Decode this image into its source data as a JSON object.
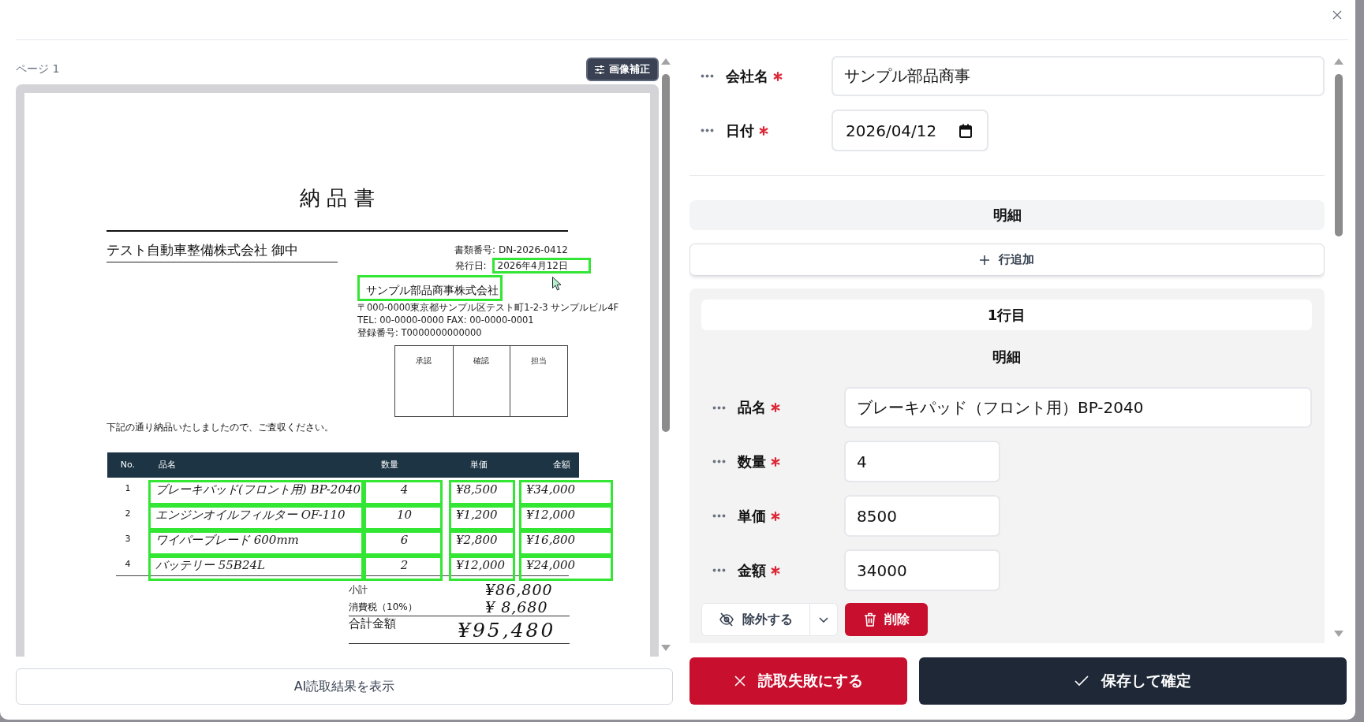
{
  "document_panel": {
    "page_label": "ページ 1",
    "adjust_button": "画像補正",
    "show_result_button": "AI読取結果を表示"
  },
  "document": {
    "title": "納 品 書",
    "recipient": "テスト自動車整備株式会社 御中",
    "meta": [
      {
        "label": "書類番号:",
        "value": "DN-2026-0412",
        "detected": false
      },
      {
        "label": "発行日:",
        "value": "2026年4月12日",
        "detected": true
      }
    ],
    "sender": {
      "name": "サンプル部品商事株式会社",
      "detected": true,
      "lines": [
        "〒000-0000東京都サンプル区テスト町1-2-3 サンプルビル4F",
        "TEL: 00-0000-0000 FAX: 00-0000-0001",
        "登録番号: T0000000000000"
      ]
    },
    "stamps": [
      "承認",
      "確認",
      "担当"
    ],
    "message": "下記の通り納品いたしましたので、ご査収ください。",
    "table": {
      "columns": [
        "No.",
        "品名",
        "数量",
        "単価",
        "金額"
      ],
      "rows": [
        {
          "cells": [
            {
              "text": "1",
              "detected": false
            },
            {
              "text": "ブレーキパッド(フロント用) BP-2040",
              "detected": true
            },
            {
              "text": "4",
              "detected": true
            },
            {
              "text": "¥8,500",
              "detected": true
            },
            {
              "text": "¥34,000",
              "detected": true
            }
          ]
        },
        {
          "cells": [
            {
              "text": "2",
              "detected": false
            },
            {
              "text": "エンジンオイルフィルター OF-110",
              "detected": true
            },
            {
              "text": "10",
              "detected": true
            },
            {
              "text": "¥1,200",
              "detected": true
            },
            {
              "text": "¥12,000",
              "detected": true
            }
          ]
        },
        {
          "cells": [
            {
              "text": "3",
              "detected": false
            },
            {
              "text": "ワイパーブレード 600mm",
              "detected": true
            },
            {
              "text": "6",
              "detected": true
            },
            {
              "text": "¥2,800",
              "detected": true
            },
            {
              "text": "¥16,800",
              "detected": true
            }
          ]
        },
        {
          "cells": [
            {
              "text": "4",
              "detected": false
            },
            {
              "text": "バッテリー 55B24L",
              "detected": true
            },
            {
              "text": "2",
              "detected": true
            },
            {
              "text": "¥12,000",
              "detected": true
            },
            {
              "text": "¥24,000",
              "detected": true
            }
          ]
        }
      ]
    },
    "totals": [
      {
        "kind": "sub",
        "label": "小計",
        "value": "¥86,800"
      },
      {
        "kind": "sub",
        "label": "消費税（10%）",
        "value": "¥ 8,680"
      },
      {
        "kind": "grand",
        "label": "合計金額",
        "value": "¥95,480"
      }
    ]
  },
  "form": {
    "fields": [
      {
        "kind": "text",
        "label": "会社名",
        "required": true,
        "value": "サンプル部品商事"
      },
      {
        "kind": "date",
        "label": "日付",
        "required": true,
        "value": "2026/04/12"
      }
    ],
    "section_title": "明細",
    "add_row_button": "行追加",
    "line_items": [
      {
        "title": "1行目",
        "subtitle": "明細",
        "fields": [
          {
            "kind": "text",
            "label": "品名",
            "required": true,
            "value": "ブレーキパッド（フロント用）BP-2040"
          },
          {
            "kind": "number",
            "label": "数量",
            "required": true,
            "value": "4"
          },
          {
            "kind": "number",
            "label": "単価",
            "required": true,
            "value": "8500"
          },
          {
            "kind": "number",
            "label": "金額",
            "required": true,
            "value": "34000"
          }
        ],
        "exclude_button": "除外する",
        "delete_button": "削除"
      }
    ]
  },
  "footer": {
    "fail_button": "読取失敗にする",
    "confirm_button": "保存して確定"
  }
}
